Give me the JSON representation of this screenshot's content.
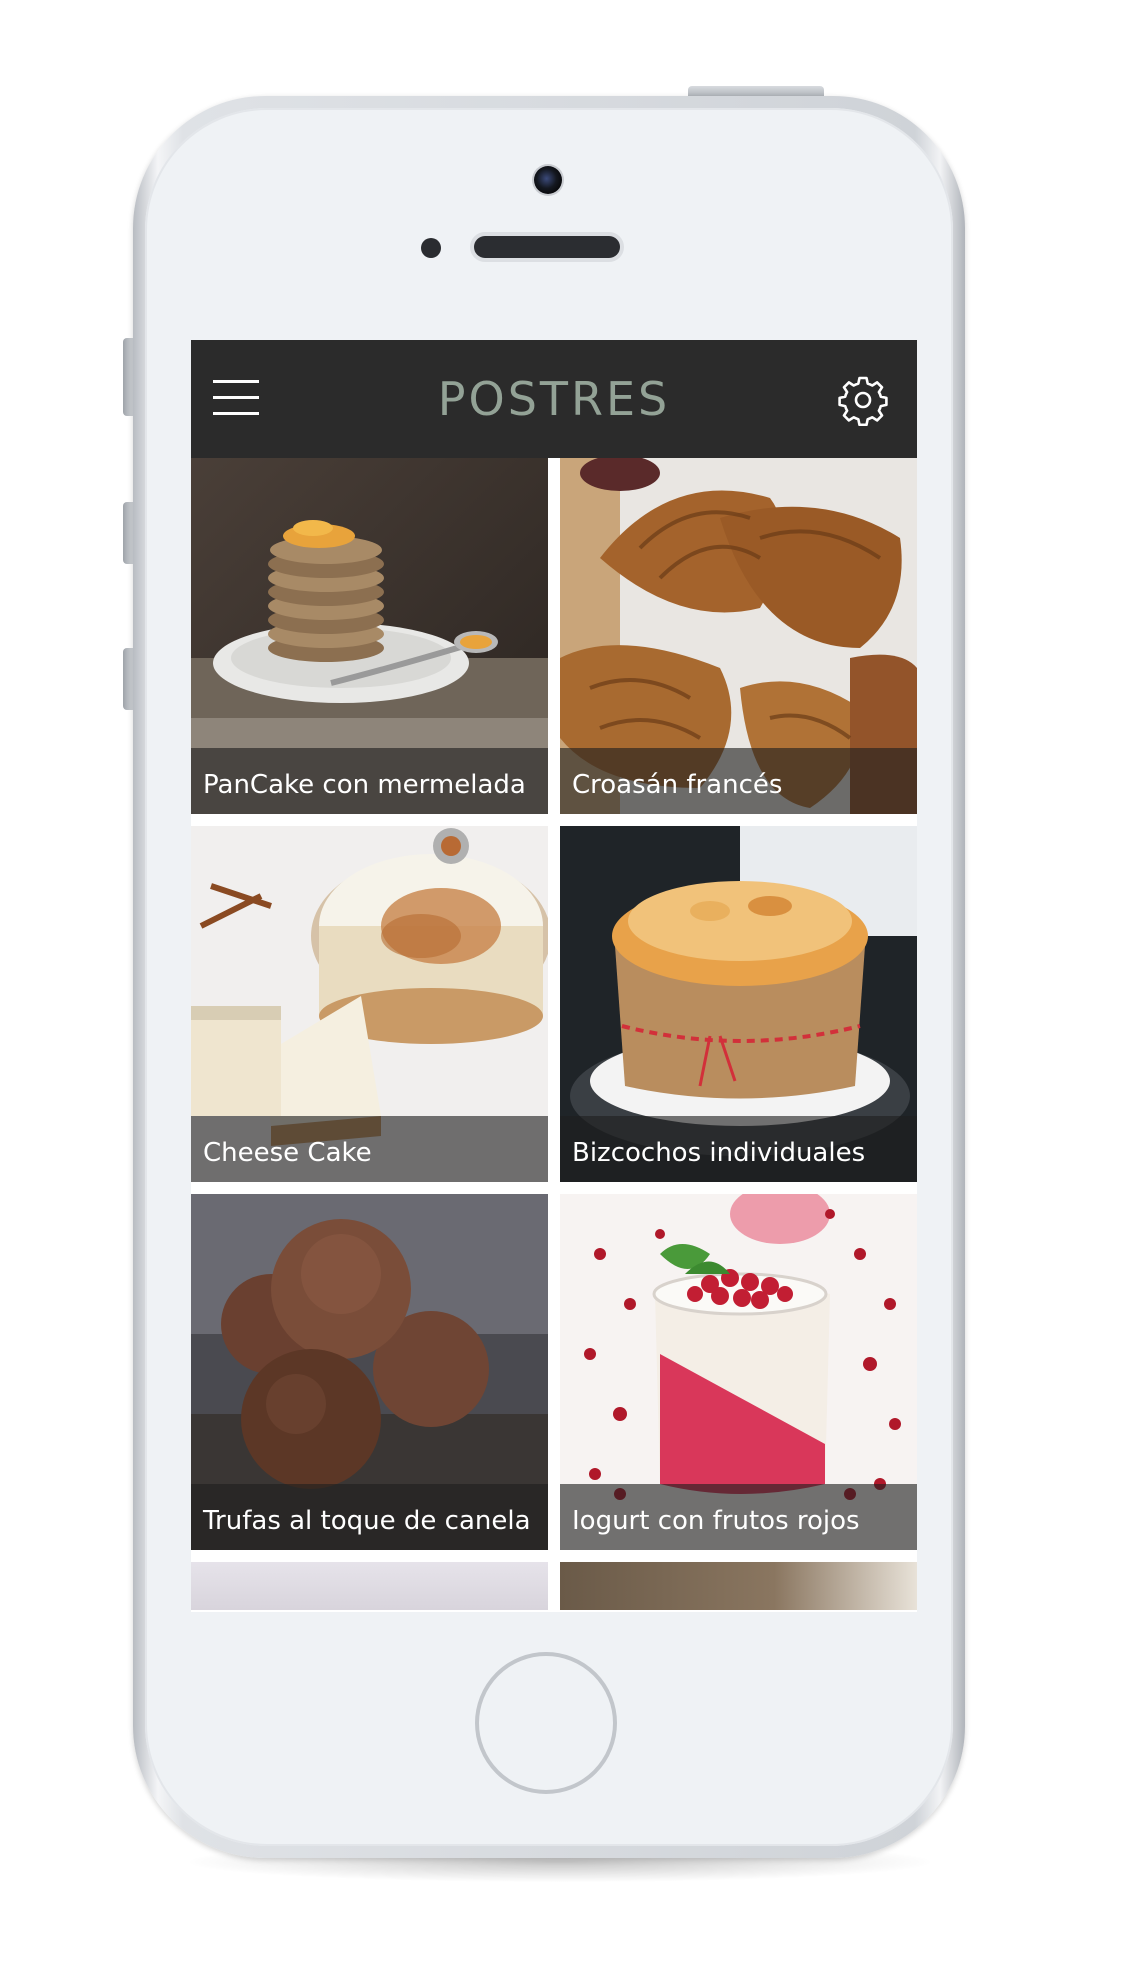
{
  "app": {
    "title": "POSTRES",
    "accent_title_color": "#93a296",
    "topbar_color": "#2b2b2b"
  },
  "toolbar": {
    "menu_icon": "hamburger-menu-icon",
    "settings_icon": "gear-icon"
  },
  "recipes": [
    {
      "name": "PanCake con mermelada"
    },
    {
      "name": "Croasán francés"
    },
    {
      "name": "Cheese Cake"
    },
    {
      "name": "Bizcochos individuales"
    },
    {
      "name": "Trufas al toque de canela"
    },
    {
      "name": "Iogurt con frutos rojos"
    }
  ],
  "device": {
    "type": "smartphone",
    "color": "white"
  }
}
